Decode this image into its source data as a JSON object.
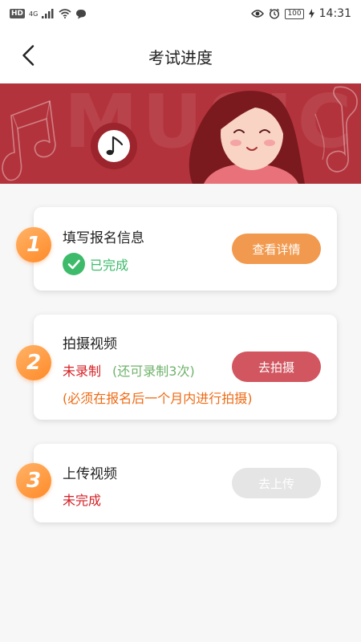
{
  "status_bar": {
    "hd": "HD",
    "network": "4G",
    "battery": "100",
    "time": "14:31"
  },
  "header": {
    "title": "考试进度"
  },
  "banner": {
    "watermark": "MUSIC"
  },
  "steps": [
    {
      "number": "1",
      "title": "填写报名信息",
      "status": "已完成",
      "button_label": "查看详情"
    },
    {
      "number": "2",
      "title": "拍摄视频",
      "status": "未录制",
      "extra": "(还可录制3次)",
      "note": "(必须在报名后一个月内进行拍摄)",
      "button_label": "去拍摄"
    },
    {
      "number": "3",
      "title": "上传视频",
      "status": "未完成",
      "button_label": "去上传"
    }
  ],
  "colors": {
    "banner_bg": "#b3333c",
    "completed_green": "#3dbb6a",
    "status_red": "#d51f24",
    "note_orange": "#ee6a13",
    "details_button": "#f19a4f",
    "shoot_button": "#d15660",
    "upload_button_disabled": "#e5e5e5"
  }
}
